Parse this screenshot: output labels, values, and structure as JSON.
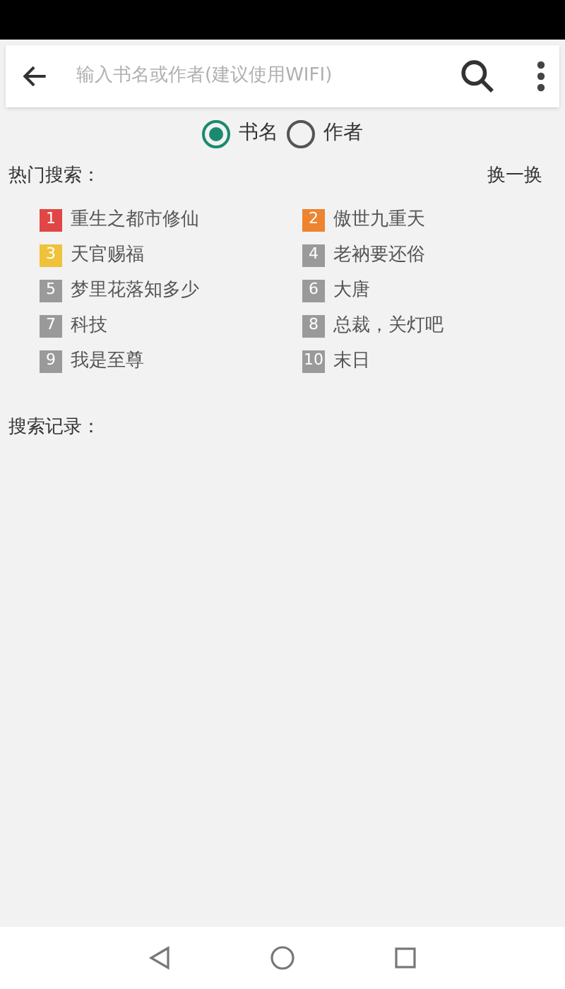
{
  "search": {
    "placeholder": "输入书名或作者(建议使用WIFI)"
  },
  "search_type": [
    {
      "label": "书名",
      "selected": true
    },
    {
      "label": "作者",
      "selected": false
    }
  ],
  "hot_search": {
    "title": "热门搜索：",
    "refresh": "换一换",
    "items": [
      {
        "rank": "1",
        "title": "重生之都市修仙",
        "color": "#e04646"
      },
      {
        "rank": "2",
        "title": "傲世九重天",
        "color": "#ee8330"
      },
      {
        "rank": "3",
        "title": "天官赐福",
        "color": "#eec23a"
      },
      {
        "rank": "4",
        "title": "老衲要还俗",
        "color": "#9a9a9a"
      },
      {
        "rank": "5",
        "title": "梦里花落知多少",
        "color": "#9a9a9a"
      },
      {
        "rank": "6",
        "title": "大唐",
        "color": "#9a9a9a"
      },
      {
        "rank": "7",
        "title": "科技",
        "color": "#9a9a9a"
      },
      {
        "rank": "8",
        "title": "总裁，关灯吧",
        "color": "#9a9a9a"
      },
      {
        "rank": "9",
        "title": "我是至尊",
        "color": "#9a9a9a"
      },
      {
        "rank": "10",
        "title": "末日",
        "color": "#9a9a9a"
      }
    ]
  },
  "history": {
    "title": "搜索记录："
  }
}
